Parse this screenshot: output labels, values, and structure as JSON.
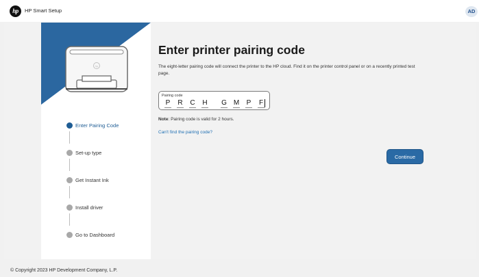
{
  "header": {
    "logo_text": "hp",
    "app_title": "HP Smart Setup",
    "user_initials": "AD"
  },
  "steps": [
    {
      "label": "Enter Pairing Code",
      "active": true
    },
    {
      "label": "Set-up type",
      "active": false
    },
    {
      "label": "Get Instant Ink",
      "active": false
    },
    {
      "label": "Install driver",
      "active": false
    },
    {
      "label": "Go to Dashboard",
      "active": false
    }
  ],
  "main": {
    "title": "Enter printer pairing code",
    "description": "The eight-letter pairing code will connect the printer to the HP cloud. Find it on the printer control panel or on a recently printed test page.",
    "pairing_code": {
      "label": "Pairing code",
      "chars": [
        "P",
        "R",
        "C",
        "H",
        "G",
        "M",
        "P",
        "F"
      ]
    },
    "note_bold": "Note",
    "note_text": ": Pairing code is valid for 2 hours.",
    "help_link": "Can't find the pairing code?",
    "continue_label": "Continue"
  },
  "footer": {
    "copyright": "© Copyright 2023 HP Development Company, L.P."
  },
  "colors": {
    "accent": "#2a6aa5",
    "active_step": "#1f5d94",
    "link": "#1f6fb3",
    "hero_blue": "#2b67a0"
  },
  "icons": {
    "logo": "hp-logo-icon",
    "printer": "printer-illustration"
  }
}
